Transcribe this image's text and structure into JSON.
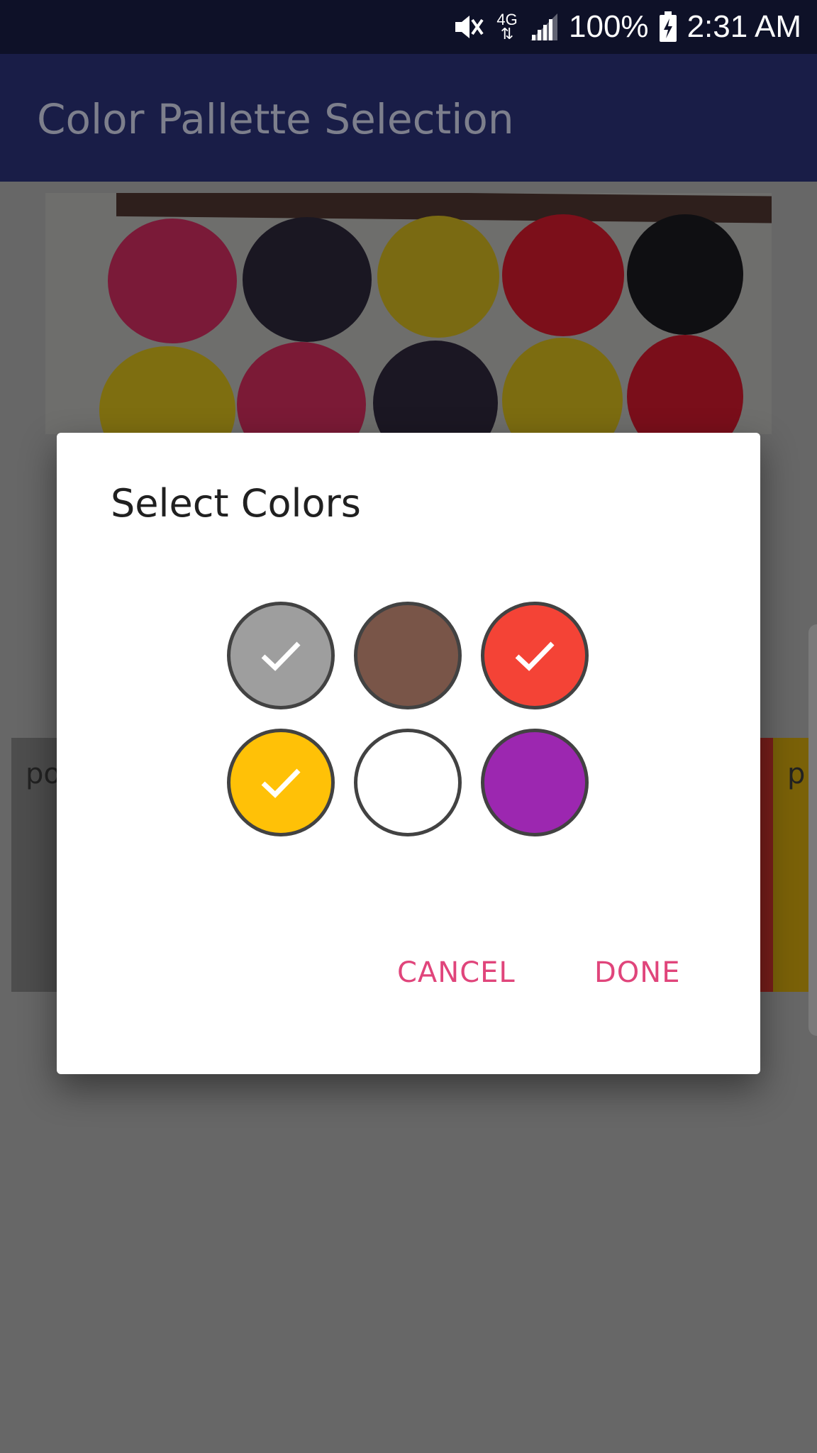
{
  "status_bar": {
    "battery": "100%",
    "time": "2:31 AM",
    "network": "4G",
    "icons": [
      "mute-icon",
      "4g-icon",
      "signal-icon",
      "battery-charging-icon"
    ]
  },
  "app_bar": {
    "title": "Color Pallette Selection"
  },
  "background_cards": [
    {
      "label": "po"
    },
    {
      "label": "p"
    }
  ],
  "dialog": {
    "title": "Select Colors",
    "swatches": [
      {
        "color": "#9e9e9e",
        "selected": true
      },
      {
        "color": "#795548",
        "selected": false
      },
      {
        "color": "#f44336",
        "selected": true
      },
      {
        "color": "#ffc107",
        "selected": true
      },
      {
        "color": "#ffffff",
        "selected": false
      },
      {
        "color": "#9c27b0",
        "selected": false
      }
    ],
    "cancel_label": "CANCEL",
    "done_label": "DONE",
    "accent_color": "#e0457b"
  }
}
